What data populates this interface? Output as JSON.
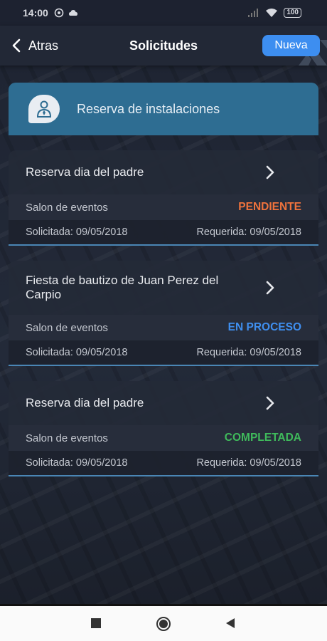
{
  "statusbar": {
    "time": "14:00",
    "battery": "100"
  },
  "appbar": {
    "back_label": "Atras",
    "title": "Solicitudes",
    "new_label": "Nueva"
  },
  "banner": {
    "label": "Reserva de instalaciones",
    "icon": "user-badge-icon"
  },
  "requests": [
    {
      "name": "Reserva dia del padre",
      "place": "Salon de eventos",
      "status": "PENDIENTE",
      "status_color": "#f0733c",
      "requested": "Solicitada: 09/05/2018",
      "required": "Requerida: 09/05/2018"
    },
    {
      "name": "Fiesta de bautizo de Juan Perez del Carpio",
      "place": "Salon de eventos",
      "status": "EN PROCESO",
      "status_color": "#3f8fef",
      "requested": "Solicitada: 09/05/2018",
      "required": "Requerida: 09/05/2018"
    },
    {
      "name": "Reserva dia del padre",
      "place": "Salon de eventos",
      "status": "COMPLETADA",
      "status_color": "#3fba5b",
      "requested": "Solicitada: 09/05/2018",
      "required": "Requerida: 09/05/2018"
    }
  ],
  "colors": {
    "accent": "#3d8ef0",
    "banner": "#2e6d92",
    "divider": "#4a86b5"
  }
}
